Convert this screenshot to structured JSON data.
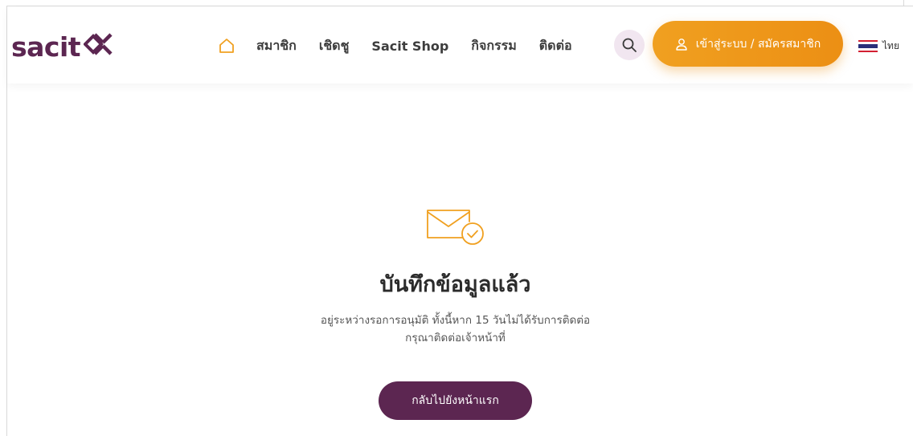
{
  "header": {
    "logo_text": "sacit",
    "nav": [
      {
        "label": "สมาชิก"
      },
      {
        "label": "เชิดชู"
      },
      {
        "label": "Sacit Shop"
      },
      {
        "label": "กิจกรรม"
      },
      {
        "label": "ติดต่อ"
      }
    ],
    "login_label": "เข้าสู่ระบบ / สมัครสมาชิก",
    "lang_label": "ไทย"
  },
  "colors": {
    "brand": "#5c2651",
    "accent": "#f0a020",
    "search_bg": "#f1e6f0"
  },
  "icons": {
    "home": "home-icon",
    "search": "search-icon",
    "user": "user-icon",
    "mail": "mail-check-icon",
    "flag": "thai-flag-icon"
  },
  "status": {
    "title": "บันทึกข้อมูลแล้ว",
    "line1": "อยู่ระหว่างรอการอนุมัติ ทั้งนี้หาก 15 วันไม่ได้รับการติดต่อ",
    "line2": "กรุณาติดต่อเจ้าหน้าที่",
    "button_label": "กลับไปยังหน้าแรก"
  }
}
